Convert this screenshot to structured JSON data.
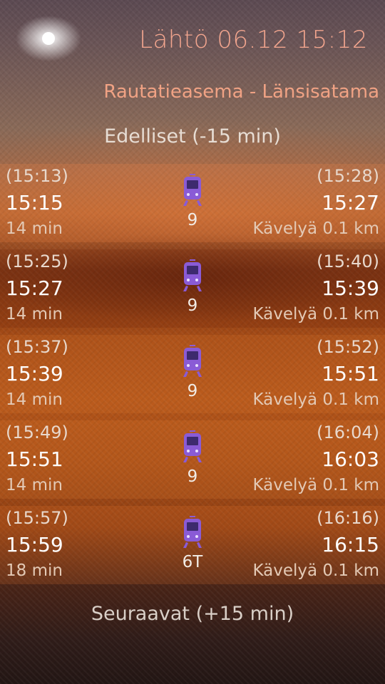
{
  "header": {
    "title": "Lähtö 06.12 15:12",
    "route": "Rautatieasema - Länsisatama"
  },
  "nav": {
    "previous_label": "Edelliset (-15 min)",
    "next_label": "Seuraavat (+15 min)"
  },
  "routes": [
    {
      "scheduled_departure": "(15:13)",
      "departure": "15:15",
      "duration": "14 min",
      "line": "9",
      "scheduled_arrival": "(15:28)",
      "arrival": "15:27",
      "walk": "Kävelyä 0.1 km",
      "icon": "tram-icon"
    },
    {
      "scheduled_departure": "(15:25)",
      "departure": "15:27",
      "duration": "14 min",
      "line": "9",
      "scheduled_arrival": "(15:40)",
      "arrival": "15:39",
      "walk": "Kävelyä 0.1 km",
      "icon": "tram-icon"
    },
    {
      "scheduled_departure": "(15:37)",
      "departure": "15:39",
      "duration": "14 min",
      "line": "9",
      "scheduled_arrival": "(15:52)",
      "arrival": "15:51",
      "walk": "Kävelyä 0.1 km",
      "icon": "tram-icon"
    },
    {
      "scheduled_departure": "(15:49)",
      "departure": "15:51",
      "duration": "14 min",
      "line": "9",
      "scheduled_arrival": "(16:04)",
      "arrival": "16:03",
      "walk": "Kävelyä 0.1 km",
      "icon": "tram-icon"
    },
    {
      "scheduled_departure": "(15:57)",
      "departure": "15:59",
      "duration": "18 min",
      "line": "6T",
      "scheduled_arrival": "(16:16)",
      "arrival": "16:15",
      "walk": "Kävelyä 0.1 km",
      "icon": "tram-icon"
    }
  ],
  "colors": {
    "title": "#f2a58e",
    "route": "#f0a284",
    "tram_icon": "#8a5bd6"
  }
}
